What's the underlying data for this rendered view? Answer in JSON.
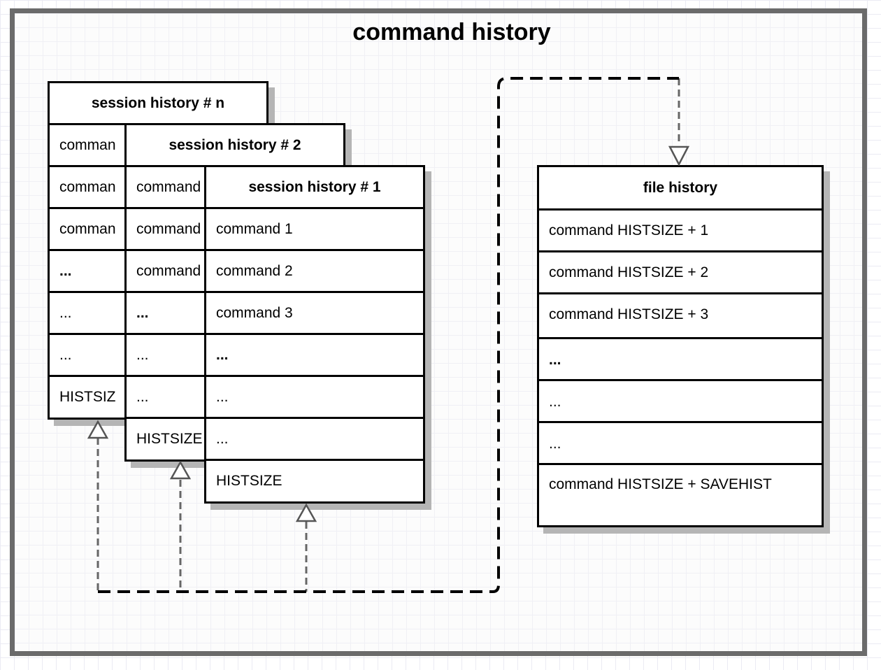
{
  "title": "command history",
  "session_tables": [
    {
      "name": "session history # n",
      "rows": [
        "comman",
        "comman",
        "comman",
        "...",
        "...",
        "...",
        "HISTSIZ"
      ],
      "bold_rows": [
        3
      ]
    },
    {
      "name": "session history # 2",
      "rows": [
        "command",
        "command",
        "command",
        "...",
        "...",
        "...",
        "HISTSIZE"
      ],
      "bold_rows": [
        3
      ]
    },
    {
      "name": "session history # 1",
      "rows": [
        "command 1",
        "command 2",
        "command 3",
        "...",
        "...",
        "...",
        "HISTSIZE"
      ],
      "bold_rows": [
        3
      ]
    }
  ],
  "file_table": {
    "name": "file history",
    "rows": [
      "command HISTSIZE + 1",
      "command HISTSIZE + 2",
      "command HISTSIZE + 3",
      "...",
      "...",
      "...",
      "command HISTSIZE + SAVEHIST"
    ],
    "bold_rows": [
      3
    ]
  },
  "connector": {
    "label": "",
    "style": "dashed",
    "arrowhead": "hollow-triangle"
  }
}
